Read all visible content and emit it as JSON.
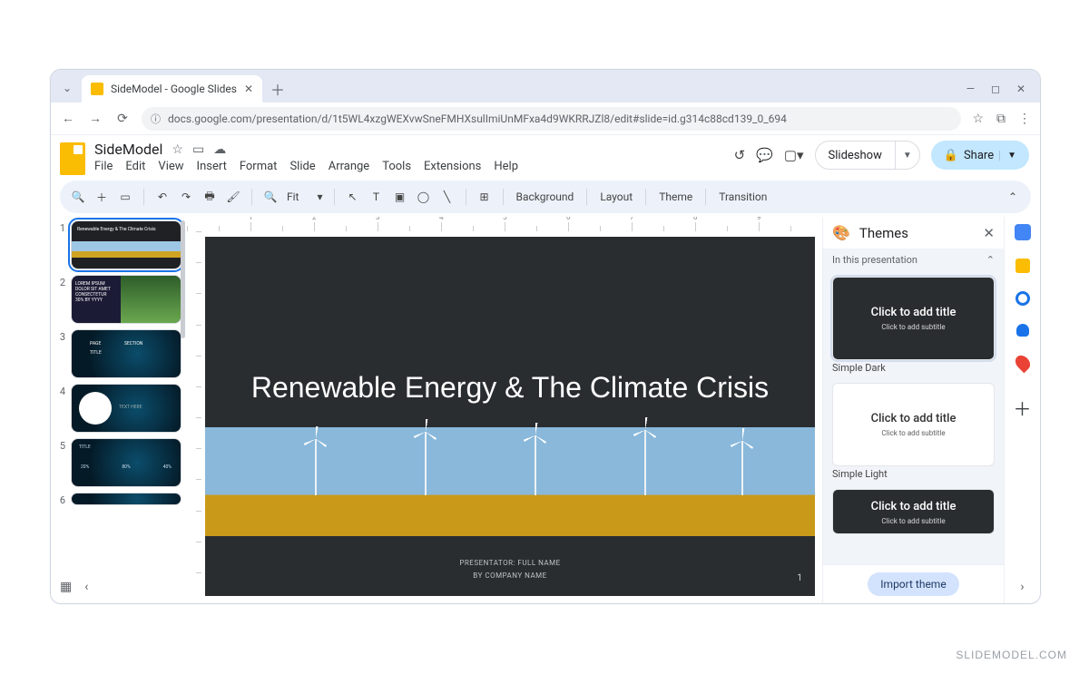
{
  "watermark": "SLIDEMODEL.COM",
  "browser": {
    "tab_title": "SideModel - Google Slides",
    "url": "docs.google.com/presentation/d/1t5WL4xzgWEXvwSneFMHXsulImiUnMFxa4d9WKRRJZl8/edit#slide=id.g314c88cd139_0_694"
  },
  "doc": {
    "title": "SideModel",
    "menus": [
      "File",
      "Edit",
      "View",
      "Insert",
      "Format",
      "Slide",
      "Arrange",
      "Tools",
      "Extensions",
      "Help"
    ],
    "slideshow_label": "Slideshow",
    "share_label": "Share"
  },
  "toolbar": {
    "zoom_label": "Fit",
    "background": "Background",
    "layout": "Layout",
    "theme": "Theme",
    "transition": "Transition"
  },
  "slides": {
    "numbers": [
      "1",
      "2",
      "3",
      "4",
      "5",
      "6"
    ],
    "thumb1_title": "Renewable Energy & The Climate Crisis",
    "thumb2_lines": "LOREM IPSUM\nDOLOR SIT AMET\nCONSECTETUR\n30% BY YYYY",
    "thumb3_a": "PAGE",
    "thumb3_b": "TITLE",
    "thumb3_c": "SECTION",
    "thumb4_txt": "TEXT HERE",
    "thumb5_a": "20%",
    "thumb5_b": "80%",
    "thumb5_c": "40%",
    "thumb5_title": "TITLE"
  },
  "canvas": {
    "title": "Renewable Energy & The Climate Crisis",
    "presenter": "PRESENTATOR: FULL NAME",
    "company": "BY COMPANY NAME",
    "page_num": "1",
    "ruler_h": [
      "",
      "",
      "1",
      "",
      "2",
      "",
      "3",
      "",
      "4",
      "",
      "5",
      "",
      "6",
      "",
      "7",
      "",
      "8",
      "",
      "9",
      ""
    ]
  },
  "themes": {
    "panel_title": "Themes",
    "section": "In this presentation",
    "card_title": "Click to add title",
    "card_sub": "Click to add subtitle",
    "name_dark": "Simple Dark",
    "name_light": "Simple Light",
    "import": "Import theme"
  }
}
